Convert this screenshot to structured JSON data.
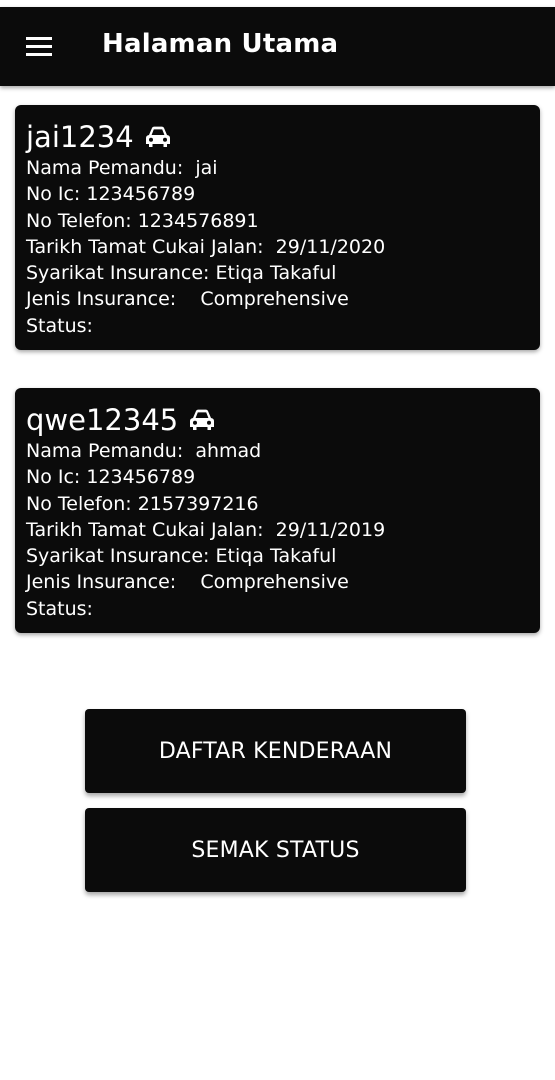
{
  "app_bar": {
    "title": "Halaman Utama",
    "menu_icon": "hamburger-menu-icon"
  },
  "vehicles": [
    {
      "plate": "jai1234",
      "icon": "car-icon",
      "driver_name_label": "Nama Pemandu:",
      "driver_name": "jai",
      "ic_label": "No Ic:",
      "ic": "123456789",
      "phone_label": "No Telefon:",
      "phone": "1234576891",
      "road_tax_label": "Tarikh Tamat Cukai Jalan:",
      "road_tax_expiry": "29/11/2020",
      "insurance_company_label": "Syarikat Insurance:",
      "insurance_company": "Etiqa Takaful",
      "insurance_type_label": "Jenis Insurance:",
      "insurance_type": "Comprehensive",
      "status_label": "Status:",
      "status": ""
    },
    {
      "plate": "qwe12345",
      "icon": "car-icon",
      "driver_name_label": "Nama Pemandu:",
      "driver_name": "ahmad",
      "ic_label": "No Ic:",
      "ic": "123456789",
      "phone_label": "No Telefon:",
      "phone": "2157397216",
      "road_tax_label": "Tarikh Tamat Cukai Jalan:",
      "road_tax_expiry": "29/11/2019",
      "insurance_company_label": "Syarikat Insurance:",
      "insurance_company": "Etiqa Takaful",
      "insurance_type_label": "Jenis Insurance:",
      "insurance_type": "Comprehensive",
      "status_label": "Status:",
      "status": ""
    }
  ],
  "buttons": {
    "register_vehicle": "DAFTAR KENDERAAN",
    "check_status": "SEMAK STATUS"
  },
  "colors": {
    "primary": "#0b0b0b",
    "text_on_primary": "#ffffff",
    "background": "#ffffff"
  }
}
